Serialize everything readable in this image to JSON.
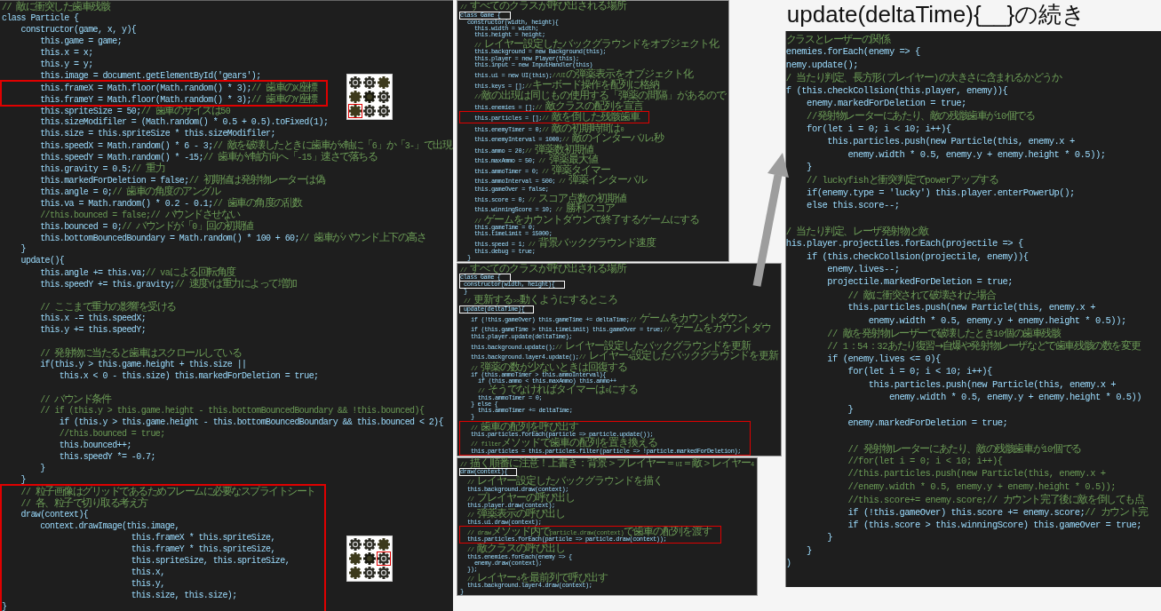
{
  "left_panel": {
    "lines": [
      {
        "kind": "line",
        "comment": "// 敵に衝突した歯車残骸"
      },
      {
        "kind": "line",
        "code": "class Particle {"
      },
      {
        "kind": "line",
        "code": "    constructor(game, x, y){"
      },
      {
        "kind": "line",
        "code": "        this.game = game;"
      },
      {
        "kind": "line",
        "code": "        this.x = x;"
      },
      {
        "kind": "line",
        "code": "        this.y = y;"
      },
      {
        "kind": "line",
        "code": "        this.image = document.getElementById('gears');"
      },
      {
        "kind": "box",
        "color": "#e00000",
        "lines": [
          {
            "kind": "line",
            "code": "        this.frameX = Math.floor(Math.random() * 3);",
            "comment": "// 歯車のX座標"
          },
          {
            "kind": "line",
            "code": "        this.frameY = Math.floor(Math.random() * 3);",
            "comment": "// 歯車のY座標"
          }
        ]
      },
      {
        "kind": "line",
        "code": "        this.spriteSize = 50;",
        "comment": "// 歯車のサイズは50"
      },
      {
        "kind": "line",
        "code": "        this.sizeModifiler = (Math.random() * 0.5 + 0.5).toFixed(1);"
      },
      {
        "kind": "line",
        "code": "        this.size = this.spriteSize * this.sizeModifiler;"
      },
      {
        "kind": "line",
        "code": "        this.speedX = Math.random() * 6 - 3;",
        "comment": "// 敵を破壊したときに歯車がx軸に「6」か「3-」で出現"
      },
      {
        "kind": "line",
        "code": "        this.speedY = Math.random() * -15;",
        "comment": "// 歯車がY軸方向へ「-15」速さで落ちる"
      },
      {
        "kind": "line",
        "code": "        this.gravity = 0.5;",
        "comment": "// 重力"
      },
      {
        "kind": "line",
        "code": "        this.markedForDeletion = false;",
        "comment": "// 初期値は発射物レーターは偽"
      },
      {
        "kind": "line",
        "code": "        this.angle = 0;",
        "comment": "// 歯車の角度のアングル"
      },
      {
        "kind": "line",
        "code": "        this.va = Math.random() * 0.2 - 0.1;",
        "comment": "// 歯車の角度の乱数"
      },
      {
        "kind": "line",
        "comment": "        //this.bounced = false;// バウンドさせない"
      },
      {
        "kind": "line",
        "code": "        this.bounced = 0;",
        "comment": "// バウンドが「0」回の初期値"
      },
      {
        "kind": "line",
        "code": "        this.bottomBouncedBoundary = Math.random() * 100 + 60;",
        "comment": "// 歯車がバウンド上下の高さ"
      },
      {
        "kind": "line",
        "code": "    }"
      },
      {
        "kind": "line",
        "code": "    update(){"
      },
      {
        "kind": "line",
        "code": "        this.angle += this.va;",
        "comment": "// vaによる回転角度"
      },
      {
        "kind": "line",
        "code": "        this.speedY += this.gravity;",
        "comment": "// 速度Yは重力によって増加"
      },
      {
        "kind": "blank"
      },
      {
        "kind": "line",
        "comment": "        // ここまで重力の影響を受ける"
      },
      {
        "kind": "line",
        "code": "        this.x -= this.speedX;"
      },
      {
        "kind": "line",
        "code": "        this.y += this.speedY;"
      },
      {
        "kind": "blank"
      },
      {
        "kind": "line",
        "comment": "        // 発射物に当たると歯車はスクロールしている"
      },
      {
        "kind": "line",
        "code": "        if(this.y > this.game.height + this.size ||"
      },
      {
        "kind": "line",
        "code": "            this.x < 0 - this.size) this.markedForDeletion = true;"
      },
      {
        "kind": "blank"
      },
      {
        "kind": "line",
        "comment": "        // バウンド条件"
      },
      {
        "kind": "line",
        "comment": "        // if (this.y > this.game.height - this.bottomBouncedBoundary && !this.bounced){"
      },
      {
        "kind": "line",
        "code": "            if (this.y > this.game.height - this.bottomBouncedBoundary && this.bounced < 2){"
      },
      {
        "kind": "line",
        "comment": "            //this.bounced = true;"
      },
      {
        "kind": "line",
        "code": "            this.bounced++;"
      },
      {
        "kind": "line",
        "code": "            this.speedY *= -0.7;"
      },
      {
        "kind": "line",
        "code": "        }"
      },
      {
        "kind": "line",
        "code": "    }"
      },
      {
        "kind": "box",
        "color": "#e00000",
        "lines": [
          {
            "kind": "line",
            "comment": "    // 粒子画像はグリッドであるためフレームに必要なスプライトシート"
          },
          {
            "kind": "line",
            "comment": "    // 各、粒子で切り取る考え方"
          },
          {
            "kind": "line",
            "code": "    draw(context){"
          },
          {
            "kind": "line",
            "code": "        context.drawImage(this.image,"
          },
          {
            "kind": "line",
            "code": "                           this.frameX * this.spriteSize,"
          },
          {
            "kind": "line",
            "code": "                           this.frameY * this.spriteSize,"
          },
          {
            "kind": "line",
            "code": "                           this.spriteSize, this.spriteSize,"
          },
          {
            "kind": "line",
            "code": "                           this.x,"
          },
          {
            "kind": "line",
            "code": "                           this.y,"
          },
          {
            "kind": "line",
            "code": "                           this.size, this.size);"
          },
          {
            "kind": "line",
            "code": "}"
          }
        ]
      }
    ],
    "sprites": [
      {
        "cells": [
          {
            "selected": false
          },
          {
            "selected": false
          },
          {
            "selected": false
          },
          {
            "selected": false
          },
          {
            "selected": false
          },
          {
            "selected": false
          },
          {
            "selected": true
          },
          {
            "selected": false
          },
          {
            "selected": false
          }
        ]
      },
      {
        "cells": [
          {
            "selected": false
          },
          {
            "selected": false
          },
          {
            "selected": false
          },
          {
            "selected": false
          },
          {
            "selected": false
          },
          {
            "selected": true
          },
          {
            "selected": false
          },
          {
            "selected": false
          },
          {
            "selected": false
          }
        ]
      }
    ]
  },
  "middle_panels": [
    {
      "lines": [
        {
          "kind": "line",
          "comment": "// すべてのクラスが呼び出される場所"
        },
        {
          "kind": "box",
          "color": "#ffffff",
          "lines": [
            {
              "kind": "line",
              "code": "class Game {"
            }
          ]
        },
        {
          "kind": "line",
          "code": "    constructor(width, height){"
        },
        {
          "kind": "line",
          "code": "        this.width = width;"
        },
        {
          "kind": "line",
          "code": "        this.height = height;"
        },
        {
          "kind": "blank"
        },
        {
          "kind": "line",
          "comment": "        // レイヤー設定したバックグラウンドをオブジェクト化"
        },
        {
          "kind": "line",
          "code": "        this.background = new Background(this);"
        },
        {
          "kind": "blank"
        },
        {
          "kind": "line",
          "code": "        this.player = new Player(this);"
        },
        {
          "kind": "line",
          "code": "        this.input = new InputHandler(this)"
        },
        {
          "kind": "blank"
        },
        {
          "kind": "line",
          "code": "        this.ui = new UI(this);",
          "comment": "//UIの弾薬表示をオブジェクト化"
        },
        {
          "kind": "line",
          "code": "        this.keys = [];",
          "comment": "//キーボード操作を配列に格納"
        },
        {
          "kind": "blank"
        },
        {
          "kind": "line",
          "comment": "        //敵の出現は同じもの使用する「弾薬の間隔」があるので"
        },
        {
          "kind": "line",
          "code": "        this.enemies = [];",
          "comment": "// 敵クラスの配列を宣言"
        },
        {
          "kind": "box",
          "color": "#e00000",
          "lines": [
            {
              "kind": "line",
              "code": "        this.particles = [];",
              "comment": "// 敵を倒した残骸歯車"
            }
          ]
        },
        {
          "kind": "line",
          "code": "        this.enemyTimer = 0;",
          "comment": "// 敵の初期時間は0"
        },
        {
          "kind": "line",
          "code": "        this.enemyInterval = 1000;",
          "comment": "// 敵のインターバル1秒"
        },
        {
          "kind": "blank"
        },
        {
          "kind": "line",
          "code": "        this.ammo = 20;",
          "comment": "// 弾薬数初期値"
        },
        {
          "kind": "line",
          "code": "        this.maxAmmo = 50;",
          "comment": " // 弾薬最大値"
        },
        {
          "kind": "line",
          "code": "        this.ammoTimer = 0;",
          "comment": " // 弾薬タイマー"
        },
        {
          "kind": "line",
          "code": "        this.ammoInterval = 500;",
          "comment": " // 弾薬インターバル"
        },
        {
          "kind": "blank"
        },
        {
          "kind": "line",
          "code": "        this.gameOver = false;"
        },
        {
          "kind": "blank"
        },
        {
          "kind": "line",
          "code": "        this.score = 0;",
          "comment": " // スコア点数の初期値"
        },
        {
          "kind": "line",
          "code": "        this.winningScore = 10;",
          "comment": " // 勝利スコア"
        },
        {
          "kind": "blank"
        },
        {
          "kind": "line",
          "comment": "        // ゲームをカウントダウンで終了するゲームにする"
        },
        {
          "kind": "line",
          "code": "        this.gameTime = 0;"
        },
        {
          "kind": "line",
          "code": "        this.timeLimit = 15000;"
        },
        {
          "kind": "blank"
        },
        {
          "kind": "line",
          "code": "        this.speed = 1;",
          "comment": " // 背景バックグラウンド速度"
        },
        {
          "kind": "line",
          "code": "        this.debug = true;"
        },
        {
          "kind": "line",
          "code": "    }"
        }
      ]
    },
    {
      "lines": [
        {
          "kind": "line",
          "comment": "// すべてのクラスが呼び出される場所"
        },
        {
          "kind": "box",
          "color": "#ffffff",
          "lines": [
            {
              "kind": "line",
              "code": "class Game {"
            }
          ]
        },
        {
          "kind": "box",
          "color": "#ffffff",
          "lines": [
            {
              "kind": "line",
              "code": "  constructor(width, height){"
            }
          ]
        },
        {
          "kind": "line",
          "code": "  }"
        },
        {
          "kind": "line",
          "comment": "  // 更新する>>動くようにするところ"
        },
        {
          "kind": "box",
          "color": "#ffffff",
          "lines": [
            {
              "kind": "line",
              "code": "  update(deltaTime){"
            }
          ]
        },
        {
          "kind": "line",
          "code": "      if (!this.gameOver) this.gameTime += deltaTime;",
          "comment": "// ゲームをカウントダウン"
        },
        {
          "kind": "line",
          "code": "      if (this.gameTime > this.timeLimit) this.gameOver = true;",
          "comment": "// ゲームをカウントダウ"
        },
        {
          "kind": "line",
          "code": "      this.player.update(deltaTime);"
        },
        {
          "kind": "blank"
        },
        {
          "kind": "line",
          "code": "      this.background.update();",
          "comment": "// レイヤー設定したバックグラウンドを更新"
        },
        {
          "kind": "line",
          "code": "      this.background.layer4.update();",
          "comment": "// レイヤー4設定したバックグラウンドを更新"
        },
        {
          "kind": "blank"
        },
        {
          "kind": "line",
          "comment": "      // 弾薬の数が少ないときは回復する"
        },
        {
          "kind": "line",
          "code": "      if (this.ammoTimer > this.ammoInterval){"
        },
        {
          "kind": "line",
          "code": "          if (this.ammo < this.maxAmmo) this.ammo++"
        },
        {
          "kind": "line",
          "comment": "          // そうでなければタイマーは0にする"
        },
        {
          "kind": "line",
          "code": "          this.ammoTimer = 0;"
        },
        {
          "kind": "line",
          "code": "      } else {"
        },
        {
          "kind": "line",
          "code": "          this.ammoTimer += deltaTime;"
        },
        {
          "kind": "line",
          "code": "      }"
        },
        {
          "kind": "blank"
        },
        {
          "kind": "box",
          "color": "#e00000",
          "lines": [
            {
              "kind": "line",
              "comment": "      // 歯車の配列を呼び出す"
            },
            {
              "kind": "line",
              "code": "      this.particles.forEach(particle => particle.update());"
            },
            {
              "kind": "line",
              "comment": "      // filterメソッドで歯車の配列を置き換える"
            },
            {
              "kind": "line",
              "code": "      this.particles = this.particles.filter(particle => !particle.markedForDeletion);"
            }
          ]
        }
      ]
    },
    {
      "lines": [
        {
          "kind": "line",
          "comment": "// 描く順番に注意！上書き：背景＞プレイヤー＝UI＝敵＞レイヤー4"
        },
        {
          "kind": "box",
          "color": "#ffffff",
          "lines": [
            {
              "kind": "line",
              "code": "draw(context){"
            }
          ]
        },
        {
          "kind": "line",
          "comment": "    // レイヤー設定したバックグラウンドを描く"
        },
        {
          "kind": "line",
          "code": "    this.background.draw(context);"
        },
        {
          "kind": "line",
          "comment": "    // プレイヤーの呼び出し"
        },
        {
          "kind": "line",
          "code": "    this.player.draw(context);"
        },
        {
          "kind": "line",
          "comment": "    // 弾薬表示の呼び出し"
        },
        {
          "kind": "line",
          "code": "    this.ui.draw(context);"
        },
        {
          "kind": "box",
          "color": "#e00000",
          "lines": [
            {
              "kind": "line",
              "comment": "    // drawメソッド内でparticle.draw(context)で歯車の配列を渡す"
            },
            {
              "kind": "line",
              "code": "    this.particles.forEach(particle => particle.draw(context));"
            }
          ]
        },
        {
          "kind": "line",
          "comment": "    // 敵クラスの呼び出し"
        },
        {
          "kind": "line",
          "code": "    this.enemies.forEach(enemy => {"
        },
        {
          "kind": "line",
          "code": "        enemy.draw(context);"
        },
        {
          "kind": "line",
          "code": "    });"
        },
        {
          "kind": "line",
          "comment": "    // レイヤー4を最前列で呼び出す"
        },
        {
          "kind": "line",
          "code": "    this.background.layer4.draw(context);"
        },
        {
          "kind": "line",
          "code": "}"
        }
      ]
    }
  ],
  "right_section": {
    "title": "update(deltaTime){__}の続き",
    "lines": [
      {
        "kind": "line",
        "comment": "クラスとレーザーの関係"
      },
      {
        "kind": "line",
        "code": "enemies.forEach(enemy => {"
      },
      {
        "kind": "line",
        "code": "nemy.update();"
      },
      {
        "kind": "line",
        "comment": "/ 当たり判定、長方形(プレイヤー)の大きさに含まれるかどうか"
      },
      {
        "kind": "line",
        "code": "f (this.checkCollsion(this.player, enemy)){"
      },
      {
        "kind": "line",
        "code": "    enemy.markedForDeletion = true;"
      },
      {
        "kind": "line",
        "comment": "    //発射物レーターにあたり、敵の残骸歯車が10個でる"
      },
      {
        "kind": "line",
        "code": "    for(let i = 0; i < 10; i++){"
      },
      {
        "kind": "line",
        "code": "        this.particles.push(new Particle(this, enemy.x +"
      },
      {
        "kind": "line",
        "code": "            enemy.width * 0.5, enemy.y + enemy.height * 0.5));"
      },
      {
        "kind": "line",
        "code": "    }"
      },
      {
        "kind": "line",
        "comment": "    // luckyfishと衝突判定でpowerアップする"
      },
      {
        "kind": "line",
        "code": "    if(enemy.type = 'lucky') this.player.enterPowerUp();"
      },
      {
        "kind": "line",
        "code": "    else this.score--;"
      },
      {
        "kind": "blank"
      },
      {
        "kind": "line",
        "comment": "/ 当たり判定、レーザ発射物と敵"
      },
      {
        "kind": "line",
        "code": "his.player.projectiles.forEach(projectile => {"
      },
      {
        "kind": "line",
        "code": "    if (this.checkCollsion(projectile, enemy)){"
      },
      {
        "kind": "line",
        "code": "        enemy.lives--;"
      },
      {
        "kind": "line",
        "code": "        projectile.markedForDeletion = true;"
      },
      {
        "kind": "line",
        "comment": "            // 敵に衝突されて破壊された場合"
      },
      {
        "kind": "line",
        "code": "            this.particles.push(new Particle(this, enemy.x +"
      },
      {
        "kind": "line",
        "code": "                enemy.width * 0.5, enemy.y + enemy.height * 0.5));"
      },
      {
        "kind": "line",
        "comment": "        // 敵を発射物レーザーで破壊したとき10個の歯車残骸"
      },
      {
        "kind": "line",
        "comment": "        // 1：54：32あたり復習→自爆や発射物レーザなどで歯車残骸の数を変更"
      },
      {
        "kind": "line",
        "code": "        if (enemy.lives <= 0){"
      },
      {
        "kind": "line",
        "code": "            for(let i = 0; i < 10; i++){"
      },
      {
        "kind": "line",
        "code": "                this.particles.push(new Particle(this, enemy.x +"
      },
      {
        "kind": "line",
        "code": "                    enemy.width * 0.5, enemy.y + enemy.height * 0.5))"
      },
      {
        "kind": "line",
        "code": "            }"
      },
      {
        "kind": "line",
        "code": "            enemy.markedForDeletion = true;"
      },
      {
        "kind": "blank"
      },
      {
        "kind": "line",
        "comment": "            // 発射物レーターにあたり、敵の残骸歯車が10個でる"
      },
      {
        "kind": "line",
        "comment": "            //for(let i = 0; i < 10; i++){"
      },
      {
        "kind": "line",
        "comment": "            //this.particles.push(new Particle(this, enemy.x +"
      },
      {
        "kind": "line",
        "comment": "            //enemy.width * 0.5, enemy.y + enemy.height * 0.5));"
      },
      {
        "kind": "line",
        "comment": "            //this.score+= enemy.score;// カウント完了後に敵を倒しても点"
      },
      {
        "kind": "line",
        "code": "            if (!this.gameOver) this.score += enemy.score;",
        "comment": "// カウント完"
      },
      {
        "kind": "line",
        "code": "            if (this.score > this.winningScore) this.gameOver = true;"
      },
      {
        "kind": "line",
        "code": "        }"
      },
      {
        "kind": "line",
        "code": "    }"
      },
      {
        "kind": "line",
        "code": ")"
      }
    ]
  }
}
